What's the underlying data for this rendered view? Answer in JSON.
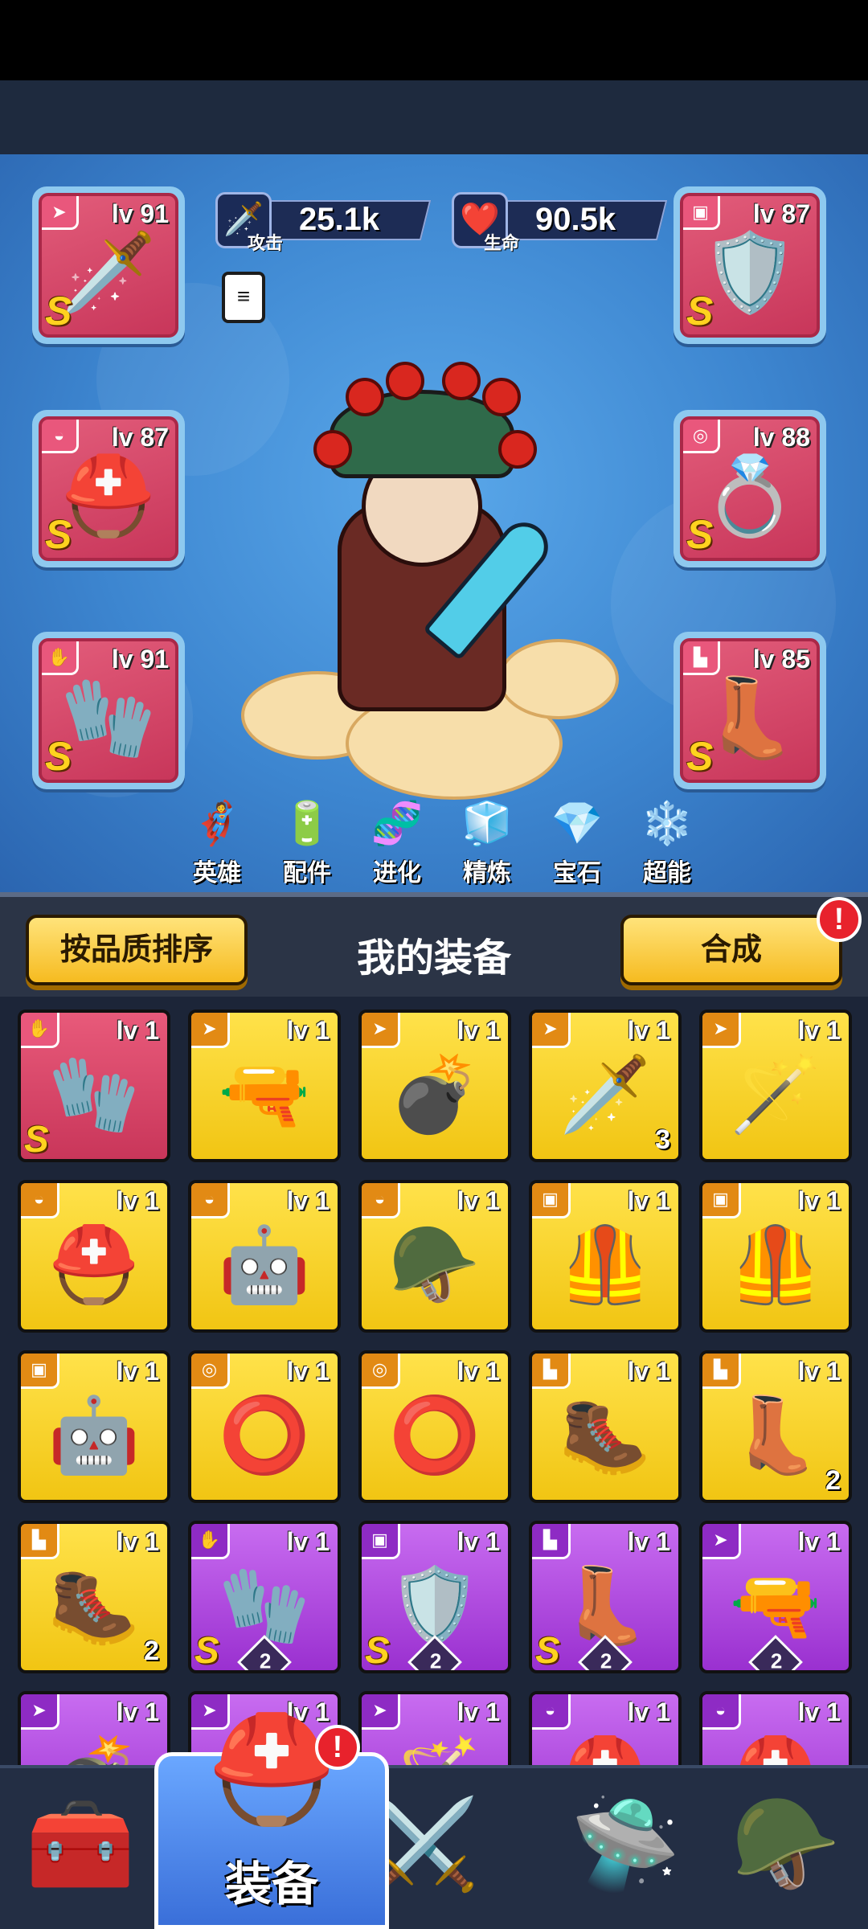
{
  "stats": {
    "attack": {
      "value": "25.1k",
      "label": "攻击"
    },
    "hp": {
      "value": "90.5k",
      "label": "生命"
    }
  },
  "equipped": [
    {
      "slot": "weapon",
      "lv": "lv 91",
      "grade": "S",
      "icon": "dagger-icon"
    },
    {
      "slot": "helmet",
      "lv": "lv 87",
      "grade": "S",
      "icon": "knight-helmet-icon"
    },
    {
      "slot": "gloves",
      "lv": "lv 91",
      "grade": "S",
      "icon": "gauntlet-icon"
    },
    {
      "slot": "armor",
      "lv": "lv 87",
      "grade": "S",
      "icon": "purple-armor-icon"
    },
    {
      "slot": "belt",
      "lv": "lv 88",
      "grade": "S",
      "icon": "gold-belt-icon"
    },
    {
      "slot": "boots",
      "lv": "lv 85",
      "grade": "S",
      "icon": "purple-boots-icon"
    }
  ],
  "hero_menu": [
    {
      "label": "英雄",
      "icon": "hero-icon"
    },
    {
      "label": "配件",
      "icon": "accessory-icon"
    },
    {
      "label": "进化",
      "icon": "evolve-icon"
    },
    {
      "label": "精炼",
      "icon": "refine-icon"
    },
    {
      "label": "宝石",
      "icon": "gem-icon"
    },
    {
      "label": "超能",
      "icon": "crystal-icon"
    }
  ],
  "header": {
    "sort_button": "按品质排序",
    "title": "我的装备",
    "merge_button": "合成",
    "merge_alert": "!"
  },
  "inventory": [
    {
      "color": "red",
      "lv": "lv 1",
      "grade": "S",
      "count": "",
      "diamond": false,
      "icon": "gauntlet-icon"
    },
    {
      "color": "gold",
      "lv": "lv 1",
      "grade": "",
      "count": "",
      "diamond": false,
      "icon": "blaster-icon"
    },
    {
      "color": "gold",
      "lv": "lv 1",
      "grade": "",
      "count": "",
      "diamond": false,
      "icon": "cannon-icon"
    },
    {
      "color": "gold",
      "lv": "lv 1",
      "grade": "",
      "count": "3",
      "diamond": false,
      "icon": "sabre-icon"
    },
    {
      "color": "gold",
      "lv": "lv 1",
      "grade": "",
      "count": "",
      "diamond": false,
      "icon": "staff-icon"
    },
    {
      "color": "gold",
      "lv": "lv 1",
      "grade": "",
      "count": "",
      "diamond": false,
      "icon": "horned-helmet-icon"
    },
    {
      "color": "gold",
      "lv": "lv 1",
      "grade": "",
      "count": "",
      "diamond": false,
      "icon": "robot-helmet-icon"
    },
    {
      "color": "gold",
      "lv": "lv 1",
      "grade": "",
      "count": "",
      "diamond": false,
      "icon": "silver-helmet-icon"
    },
    {
      "color": "gold",
      "lv": "lv 1",
      "grade": "",
      "count": "",
      "diamond": false,
      "icon": "dark-armor-icon"
    },
    {
      "color": "gold",
      "lv": "lv 1",
      "grade": "",
      "count": "",
      "diamond": false,
      "icon": "gold-armor-icon"
    },
    {
      "color": "gold",
      "lv": "lv 1",
      "grade": "",
      "count": "",
      "diamond": false,
      "icon": "mech-armor-icon"
    },
    {
      "color": "gold",
      "lv": "lv 1",
      "grade": "",
      "count": "",
      "diamond": false,
      "icon": "bronze-belt-icon"
    },
    {
      "color": "gold",
      "lv": "lv 1",
      "grade": "",
      "count": "",
      "diamond": false,
      "icon": "silver-belt-icon"
    },
    {
      "color": "gold",
      "lv": "lv 1",
      "grade": "",
      "count": "",
      "diamond": false,
      "icon": "red-boots-icon"
    },
    {
      "color": "gold",
      "lv": "lv 1",
      "grade": "",
      "count": "2",
      "diamond": false,
      "icon": "white-boots-icon"
    },
    {
      "color": "gold",
      "lv": "lv 1",
      "grade": "",
      "count": "2",
      "diamond": false,
      "icon": "steel-boots-icon"
    },
    {
      "color": "purple",
      "lv": "lv 1",
      "grade": "S",
      "count": "2",
      "diamond": true,
      "icon": "gauntlet-icon"
    },
    {
      "color": "purple",
      "lv": "lv 1",
      "grade": "S",
      "count": "2",
      "diamond": true,
      "icon": "purple-armor-icon"
    },
    {
      "color": "purple",
      "lv": "lv 1",
      "grade": "S",
      "count": "2",
      "diamond": true,
      "icon": "gold-boots-icon"
    },
    {
      "color": "purple",
      "lv": "lv 1",
      "grade": "",
      "count": "2",
      "diamond": true,
      "icon": "blaster-icon"
    },
    {
      "color": "purple",
      "lv": "lv 1",
      "grade": "",
      "count": "",
      "diamond": false,
      "icon": "cannon-icon"
    },
    {
      "color": "purple",
      "lv": "lv 1",
      "grade": "",
      "count": "",
      "diamond": false,
      "icon": "blaster-icon"
    },
    {
      "color": "purple",
      "lv": "lv 1",
      "grade": "",
      "count": "",
      "diamond": false,
      "icon": "staff-icon"
    },
    {
      "color": "purple",
      "lv": "lv 1",
      "grade": "",
      "count": "",
      "diamond": false,
      "icon": "helmet-icon"
    },
    {
      "color": "purple",
      "lv": "lv 1",
      "grade": "",
      "count": "",
      "diamond": false,
      "icon": "helmet-icon"
    }
  ],
  "bottom_nav": [
    {
      "label": "",
      "icon": "treasure-chest-icon"
    },
    {
      "label": "装备",
      "icon": "gold-helmet-icon",
      "active": true
    },
    {
      "label": "",
      "icon": "crossed-swords-icon"
    },
    {
      "label": "",
      "icon": "ufo-icon"
    },
    {
      "label": "",
      "icon": "winged-helmet-icon"
    }
  ],
  "nav_alert": "!"
}
